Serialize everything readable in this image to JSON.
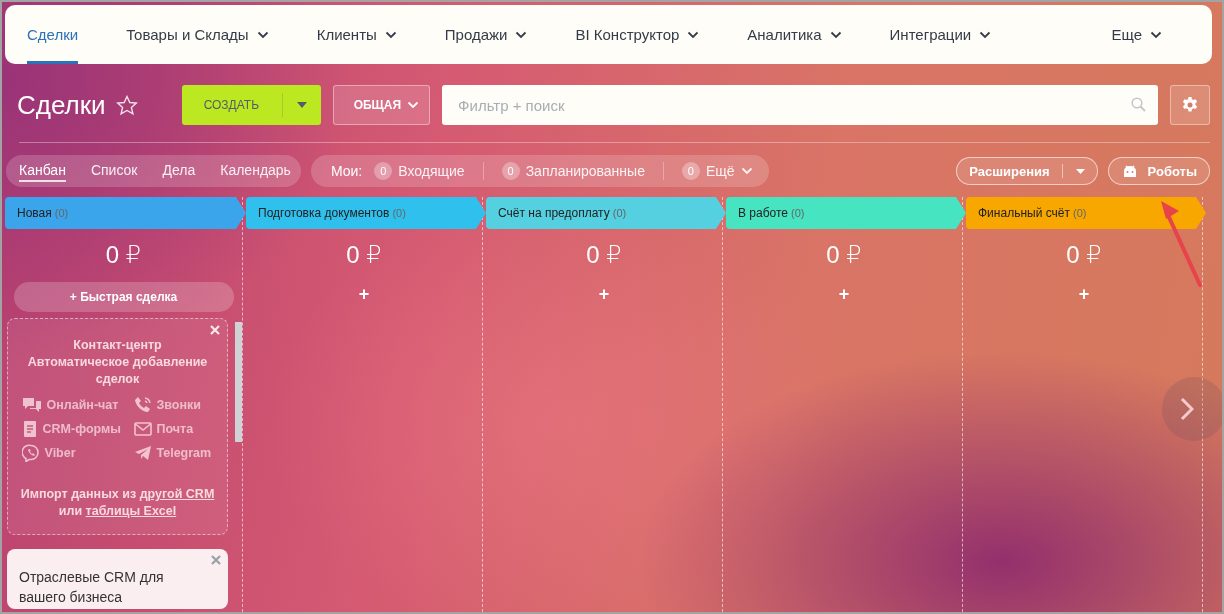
{
  "nav": {
    "items": [
      {
        "label": "Сделки",
        "selected": true,
        "dropdown": false
      },
      {
        "label": "Товары и Склады",
        "selected": false,
        "dropdown": true
      },
      {
        "label": "Клиенты",
        "selected": false,
        "dropdown": true
      },
      {
        "label": "Продажи",
        "selected": false,
        "dropdown": true
      },
      {
        "label": "BI Конструктор",
        "selected": false,
        "dropdown": true
      },
      {
        "label": "Аналитика",
        "selected": false,
        "dropdown": true
      },
      {
        "label": "Интеграции",
        "selected": false,
        "dropdown": true
      },
      {
        "label": "Еще",
        "selected": false,
        "dropdown": true
      }
    ]
  },
  "header": {
    "title": "Сделки",
    "starred": false,
    "create_button": "СОЗДАТЬ",
    "category_button": "ОБЩАЯ",
    "search": {
      "placeholder": "Фильтр + поиск"
    }
  },
  "toolbar": {
    "views": [
      {
        "label": "Канбан",
        "selected": true
      },
      {
        "label": "Список",
        "selected": false
      },
      {
        "label": "Дела",
        "selected": false
      },
      {
        "label": "Календарь",
        "selected": false
      }
    ],
    "counters_label": "Мои:",
    "counters": [
      {
        "count": "0",
        "label": "Входящие",
        "dropdown": false
      },
      {
        "count": "0",
        "label": "Запланированные",
        "dropdown": false
      },
      {
        "count": "0",
        "label": "Ещё",
        "dropdown": true
      }
    ],
    "extensions_button": "Расширения",
    "robots_button": "Роботы"
  },
  "stages": [
    {
      "name": "Новая",
      "count": "(0)",
      "color": "#3ba5ec",
      "sum": "0 ₽",
      "action": "+ Быстрая сделка"
    },
    {
      "name": "Подготовка документов",
      "count": "(0)",
      "color": "#2fc0ed",
      "sum": "0 ₽",
      "action": "+"
    },
    {
      "name": "Счёт на предоплату",
      "count": "(0)",
      "color": "#55d0e0",
      "sum": "0 ₽",
      "action": "+"
    },
    {
      "name": "В работе",
      "count": "(0)",
      "color": "#47e4c2",
      "sum": "0 ₽",
      "action": "+"
    },
    {
      "name": "Финальный счёт",
      "count": "(0)",
      "color": "#f7a700",
      "sum": "0 ₽",
      "action": "+"
    }
  ],
  "contact_card": {
    "title": "Контакт-центр",
    "subtitle": "Автоматическое добавление сделок",
    "channels": [
      {
        "kind": "chat",
        "label": "Онлайн-чат"
      },
      {
        "kind": "phone",
        "label": "Звонки"
      },
      {
        "kind": "form",
        "label": "CRM-формы"
      },
      {
        "kind": "mail",
        "label": "Почта"
      },
      {
        "kind": "viber",
        "label": "Viber"
      },
      {
        "kind": "telegram",
        "label": "Telegram"
      }
    ],
    "import_text": "Импорт данных из",
    "import_link": "другой CRM",
    "import_or": "или",
    "excel_link": "таблицы Excel"
  },
  "promo_card": {
    "text": "Отраслевые CRM для вашего бизнеса"
  }
}
